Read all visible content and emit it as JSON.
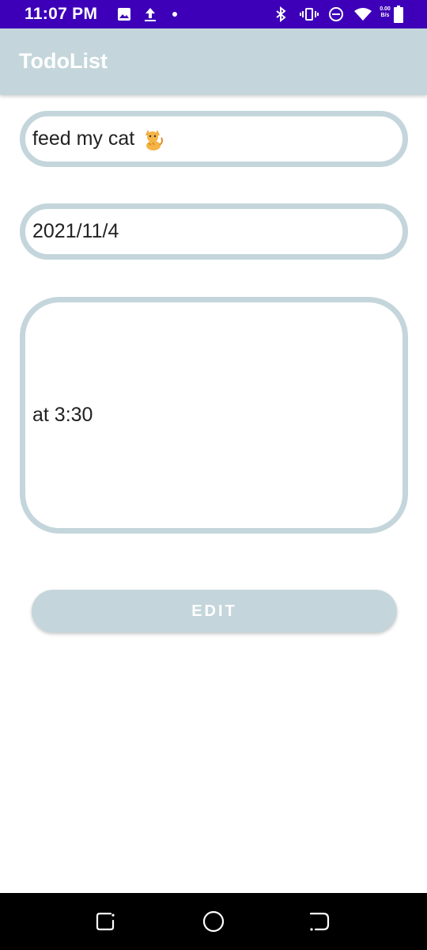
{
  "status_bar": {
    "time": "11:07 PM",
    "net_speed_value": "0.00",
    "net_speed_unit": "B/s",
    "icons": [
      "image-icon",
      "upload-icon",
      "dot-icon",
      "bluetooth-icon",
      "vibrate-icon",
      "dnd-icon",
      "wifi-icon",
      "battery-icon"
    ]
  },
  "app_bar": {
    "title": "TodoList"
  },
  "form": {
    "title_value": "feed my cat",
    "title_emoji": "cat-emoji",
    "date_value": "2021/11/4",
    "note_value": "at 3:30"
  },
  "actions": {
    "edit_label": "EDIT"
  },
  "nav_bar": {
    "buttons": [
      "recents-icon",
      "home-icon",
      "back-icon"
    ]
  },
  "colors": {
    "status_bar": "#3d00b8",
    "accent": "#c4d6db",
    "nav_bar": "#000000"
  }
}
